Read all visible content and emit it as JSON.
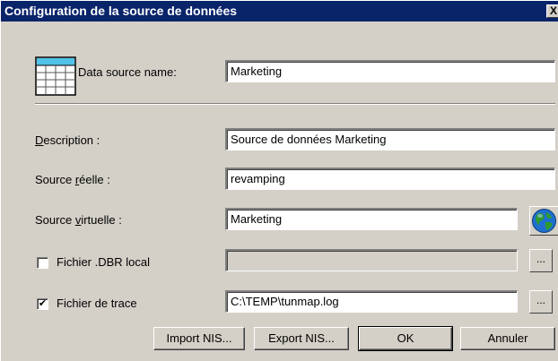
{
  "window": {
    "title": "Configuration de la source de données",
    "close_glyph": "X"
  },
  "fields": {
    "data_source_name": {
      "label": "Data source name:",
      "value": "Marketing"
    },
    "description": {
      "label_u": "D",
      "label_rest": "escription :",
      "value": "Source de données Marketing"
    },
    "source_reelle": {
      "label_pre": "Source ",
      "label_u": "r",
      "label_rest": "éelle :",
      "value": "revamping"
    },
    "source_virtuelle": {
      "label_pre": "Source ",
      "label_u": "v",
      "label_rest": "irtuelle :",
      "value": "Marketing"
    },
    "fichier_dbr": {
      "label": "Fichier .DBR local",
      "checked": false,
      "value": ""
    },
    "fichier_trace": {
      "label": "Fichier de trace",
      "checked": true,
      "value": "C:\\TEMP\\tunmap.log",
      "check_glyph": "✔"
    }
  },
  "buttons": {
    "import_nis": "Import NIS...",
    "export_nis": "Export NIS...",
    "ok": "OK",
    "annuler": "Annuler",
    "browse": "..."
  },
  "icons": {
    "table": "table-grid-icon",
    "globe": "globe-icon",
    "close": "close-icon"
  },
  "colors": {
    "titlebar": "#0a246a",
    "face": "#d4d0c8",
    "grid_header": "#4fc3e8"
  }
}
